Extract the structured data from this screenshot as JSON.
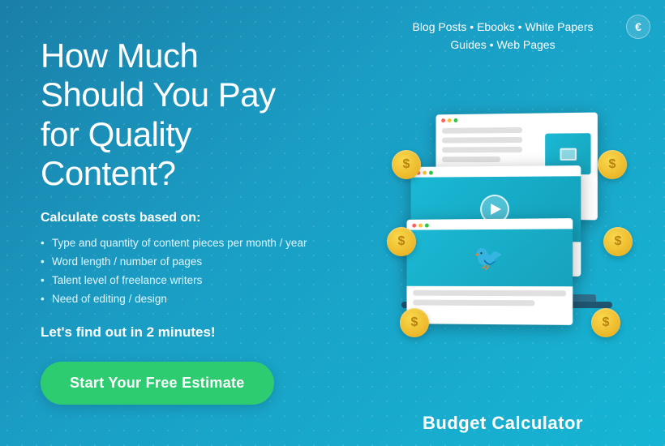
{
  "page": {
    "title": "Content Budget Calculator",
    "background_colors": {
      "primary": "#1a7fa8",
      "secondary": "#16b5d4"
    }
  },
  "header": {
    "nav_text": "Blog Posts • Ebooks • White Papers",
    "nav_text2": "Guides • Web Pages",
    "logo_symbol": "€"
  },
  "left": {
    "main_heading": "How Much Should You Pay for Quality Content?",
    "sub_heading": "Calculate costs based on:",
    "bullets": [
      "Type and quantity of content pieces per month / year",
      "Word length / number of pages",
      "Talent level of freelance writers",
      "Need of editing / design"
    ],
    "find_out": "Let's find out in 2 minutes!",
    "cta_label": "Start Your Free Estimate"
  },
  "right": {
    "illustration_label": "Budget Calculator",
    "coins": [
      "$",
      "$",
      "$",
      "$",
      "$",
      "$"
    ]
  }
}
